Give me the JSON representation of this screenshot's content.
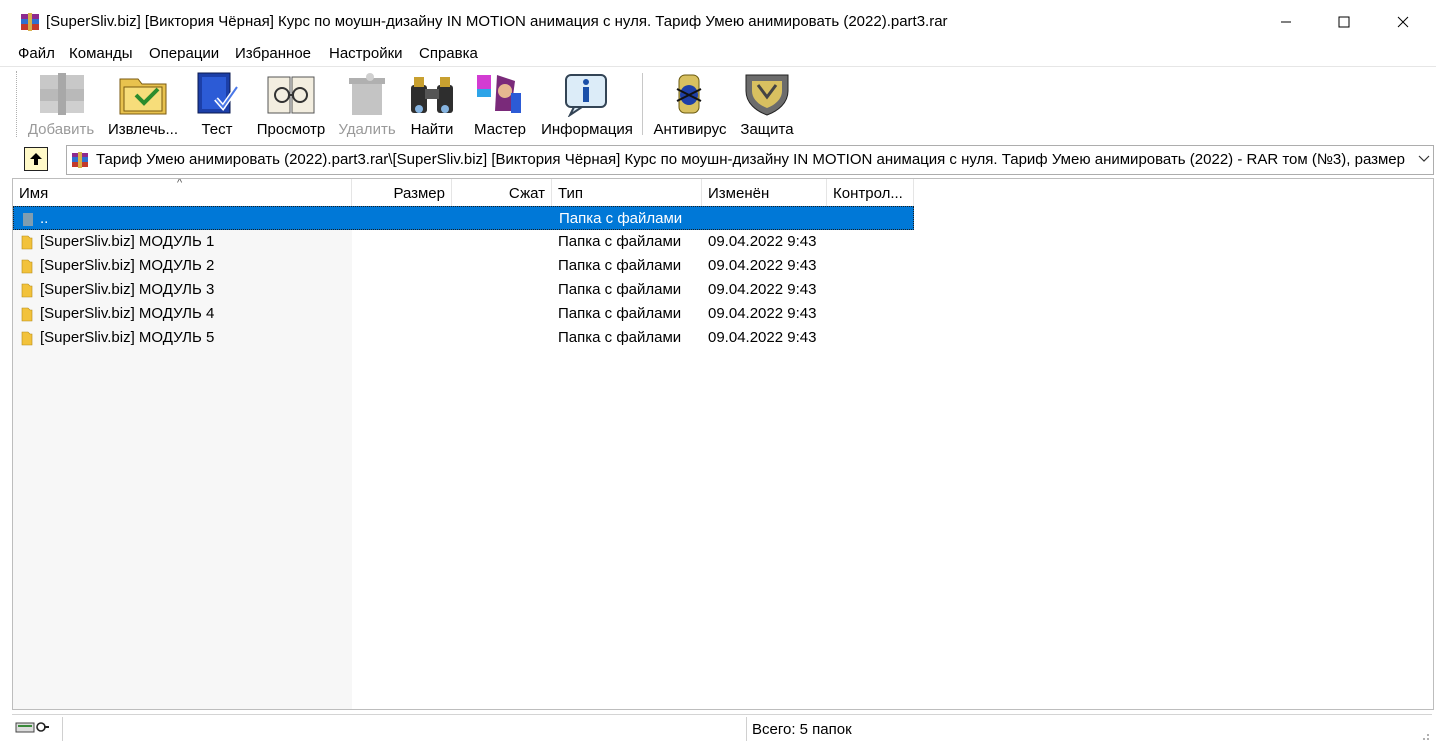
{
  "window": {
    "title": "[SuperSliv.biz] [Виктория Чёрная] Курс по моушн-дизайну IN MOTION анимация с нуля. Тариф Умею анимировать (2022).part3.rar",
    "icon": "winrar-books-icon"
  },
  "menu": [
    {
      "label": "Файл"
    },
    {
      "label": "Команды"
    },
    {
      "label": "Операции"
    },
    {
      "label": "Избранное"
    },
    {
      "label": "Настройки"
    },
    {
      "label": "Справка"
    }
  ],
  "toolbar": [
    {
      "label": "Добавить",
      "icon": "add-archive-icon",
      "disabled": true
    },
    {
      "label": "Извлечь...",
      "icon": "extract-folder-icon",
      "disabled": false
    },
    {
      "label": "Тест",
      "icon": "test-book-icon",
      "disabled": false
    },
    {
      "label": "Просмотр",
      "icon": "view-glasses-icon",
      "disabled": false
    },
    {
      "label": "Удалить",
      "icon": "delete-icon",
      "disabled": true
    },
    {
      "label": "Найти",
      "icon": "binoculars-icon",
      "disabled": false
    },
    {
      "label": "Мастер",
      "icon": "wizard-icon",
      "disabled": false
    },
    {
      "label": "Информация",
      "icon": "info-icon",
      "disabled": false
    },
    {
      "label": "Антивирус",
      "icon": "antivirus-bug-icon",
      "disabled": false
    },
    {
      "label": "Защита",
      "icon": "shield-icon",
      "disabled": false
    }
  ],
  "path": {
    "text": "[SuperSliv.biz] [Виктория Чёрная] Курс по моушн-дизайну IN MOTION анимация с нуля. Тариф Умею анимировать (2022).part3.rar\\[SuperSliv.biz] [Виктория Чёрная] Курс по моушн-дизайну IN MOTION анимация с нуля. Тариф Умею анимировать (2022) - RAR том (№3), размер"
  },
  "columns": [
    {
      "label": "Имя"
    },
    {
      "label": "Размер"
    },
    {
      "label": "Сжат"
    },
    {
      "label": "Тип"
    },
    {
      "label": "Изменён"
    },
    {
      "label": "Контрол..."
    }
  ],
  "rows": [
    {
      "name": "..",
      "size": "",
      "packed": "",
      "type": "Папка с файлами",
      "modified": "",
      "crc": "",
      "selected": true
    },
    {
      "name": "[SuperSliv.biz] МОДУЛЬ 1",
      "size": "",
      "packed": "",
      "type": "Папка с файлами",
      "modified": "09.04.2022 9:43",
      "crc": "",
      "selected": false
    },
    {
      "name": "[SuperSliv.biz] МОДУЛЬ 2",
      "size": "",
      "packed": "",
      "type": "Папка с файлами",
      "modified": "09.04.2022 9:43",
      "crc": "",
      "selected": false
    },
    {
      "name": "[SuperSliv.biz] МОДУЛЬ 3",
      "size": "",
      "packed": "",
      "type": "Папка с файлами",
      "modified": "09.04.2022 9:43",
      "crc": "",
      "selected": false
    },
    {
      "name": "[SuperSliv.biz] МОДУЛЬ 4",
      "size": "",
      "packed": "",
      "type": "Папка с файлами",
      "modified": "09.04.2022 9:43",
      "crc": "",
      "selected": false
    },
    {
      "name": "[SuperSliv.biz] МОДУЛЬ 5",
      "size": "",
      "packed": "",
      "type": "Папка с файлами",
      "modified": "09.04.2022 9:43",
      "crc": "",
      "selected": false
    }
  ],
  "status": {
    "summary": "Всего: 5 папок"
  },
  "colors": {
    "selection": "#0078d7",
    "folder": "#f2c23b"
  }
}
